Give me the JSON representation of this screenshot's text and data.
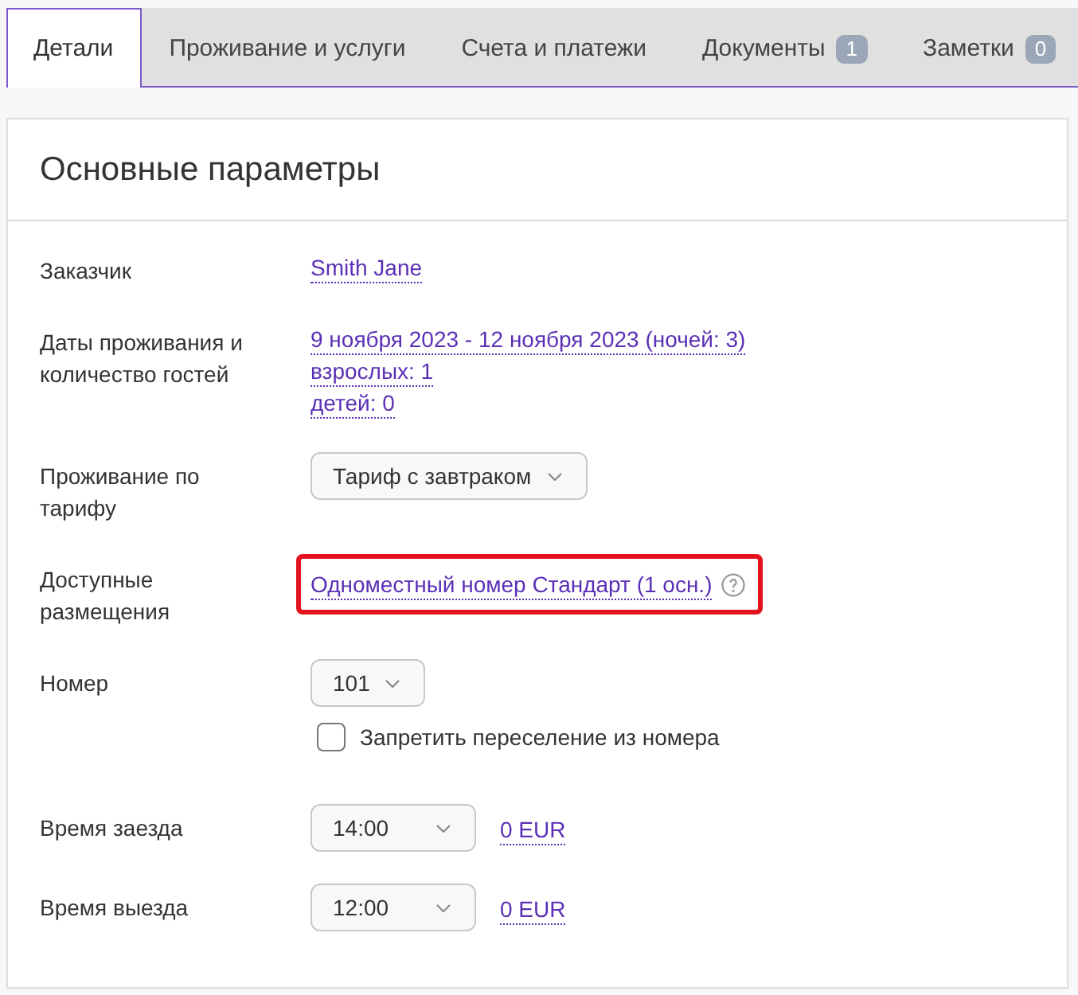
{
  "tabs": [
    {
      "label": "Детали",
      "selected": true
    },
    {
      "label": "Проживание и услуги",
      "selected": false
    },
    {
      "label": "Счета и платежи",
      "selected": false
    },
    {
      "label": "Документы",
      "badge": "1",
      "selected": false
    },
    {
      "label": "Заметки",
      "badge": "0",
      "selected": false
    }
  ],
  "panel": {
    "title": "Основные параметры",
    "fields": [
      {
        "kind": "links",
        "label": "Заказчик",
        "links": [
          "Smith Jane"
        ]
      },
      {
        "kind": "links",
        "label": "Даты проживания и количество гостей",
        "links": [
          "9 ноября 2023 - 12 ноября 2023 (ночей: 3)",
          "взрослых: 1",
          "детей: 0"
        ]
      },
      {
        "kind": "dropdown",
        "label": "Проживание по тарифу",
        "value": "Тариф с завтраком"
      },
      {
        "kind": "links",
        "label": "Доступные размещения",
        "links": [
          "Одноместный номер Стандарт (1 осн.)"
        ],
        "info": true,
        "highlighted": true
      },
      {
        "kind": "dropdown",
        "label": "Номер",
        "value": "101",
        "checkbox": {
          "label": "Запретить переселение из номера",
          "checked": false
        }
      },
      {
        "kind": "time",
        "label": "Время заезда",
        "value": "14:00",
        "price": "0 EUR"
      },
      {
        "kind": "time",
        "label": "Время выезда",
        "value": "12:00",
        "price": "0 EUR"
      }
    ]
  }
}
